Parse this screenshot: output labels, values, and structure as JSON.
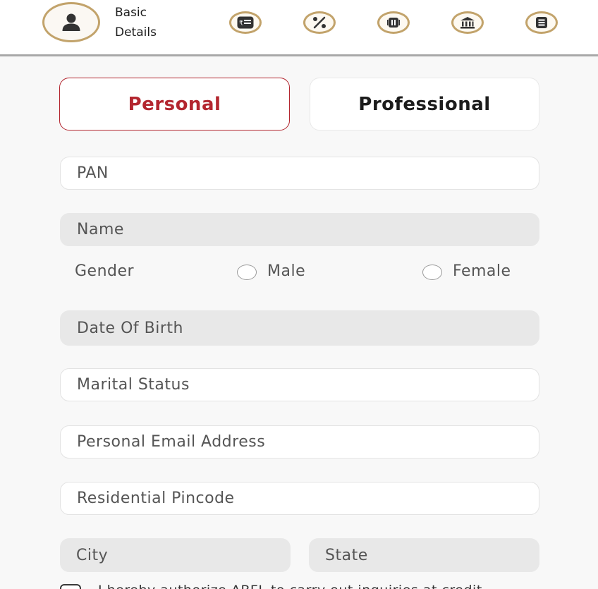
{
  "stepper": {
    "active_step": {
      "icon": "user-icon",
      "label_line1": "Basic",
      "label_line2": "Details"
    },
    "steps": [
      {
        "icon": "rupee-card-icon"
      },
      {
        "icon": "percent-icon"
      },
      {
        "icon": "document-icon"
      },
      {
        "icon": "bank-icon"
      },
      {
        "icon": "list-icon"
      }
    ],
    "accent_color": "#c2a36b"
  },
  "tabs": {
    "personal": "Personal",
    "professional": "Professional",
    "active": "personal",
    "active_color": "#b3262f"
  },
  "form": {
    "pan_placeholder": "PAN",
    "name_placeholder": "Name",
    "gender": {
      "label": "Gender",
      "options": [
        "Male",
        "Female"
      ]
    },
    "dob_placeholder": "Date Of Birth",
    "marital_status_placeholder": "Marital Status",
    "email_placeholder": "Personal Email Address",
    "pincode_placeholder": "Residential Pincode",
    "city_placeholder": "City",
    "state_placeholder": "State"
  },
  "consent": {
    "text": "I hereby authorize ABFL to carry out inquiries at credit"
  }
}
